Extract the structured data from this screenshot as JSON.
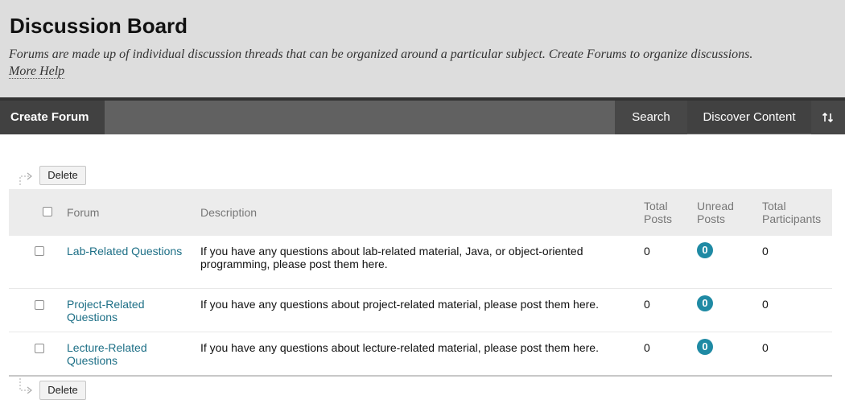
{
  "header": {
    "title": "Discussion Board",
    "description": "Forums are made up of individual discussion threads that can be organized around a particular subject. Create Forums to organize discussions.",
    "help_link": "More Help"
  },
  "toolbar": {
    "create_label": "Create Forum",
    "search_label": "Search",
    "discover_label": "Discover Content",
    "sort_icon": "sort-icon"
  },
  "actions": {
    "delete_label": "Delete"
  },
  "table": {
    "columns": {
      "forum": "Forum",
      "description": "Description",
      "total_posts": [
        "Total",
        "Posts"
      ],
      "unread_posts": [
        "Unread",
        "Posts"
      ],
      "total_participants": [
        "Total",
        "Participants"
      ]
    },
    "rows": [
      {
        "forum": "Lab-Related Questions",
        "description": "If you have any questions about lab-related material, Java, or object-oriented programming, please post them here.",
        "total_posts": "0",
        "unread_posts": "0",
        "total_participants": "0"
      },
      {
        "forum": "Project-Related Questions",
        "description": "If you have any questions about project-related material, please post them here.",
        "total_posts": "0",
        "unread_posts": "0",
        "total_participants": "0"
      },
      {
        "forum": "Lecture-Related Questions",
        "description": "If you have any questions about lecture-related material, please post them here.",
        "total_posts": "0",
        "unread_posts": "0",
        "total_participants": "0"
      }
    ]
  },
  "colors": {
    "header_bg": "#dddddd",
    "toolbar_bg": "#5b5b5b",
    "link": "#1d6f86",
    "badge": "#1f8aa4"
  }
}
